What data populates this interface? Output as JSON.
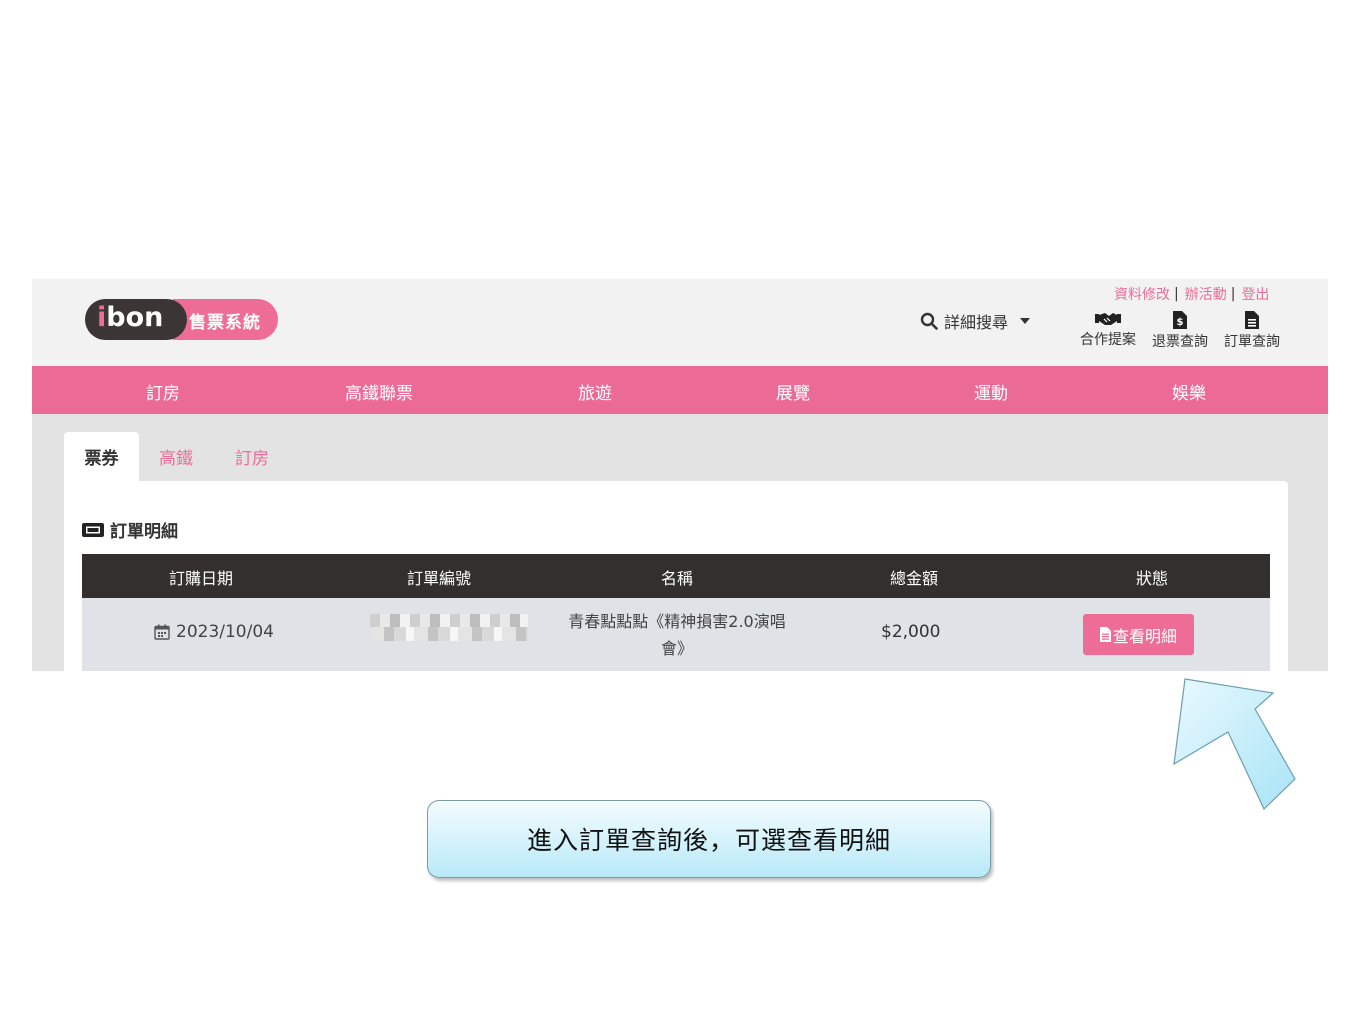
{
  "header": {
    "logo_word": "bon",
    "logo_i": "i",
    "logo_tagline": "售票系統",
    "search_label": "詳細搜尋",
    "top_links": [
      {
        "label": "資料修改"
      },
      {
        "label": "辦活動"
      },
      {
        "label": "登出"
      }
    ],
    "quick_links": [
      {
        "label": "合作提案",
        "icon": "handshake-icon"
      },
      {
        "label": "退票查詢",
        "icon": "refund-document-icon"
      },
      {
        "label": "訂單查詢",
        "icon": "document-icon"
      }
    ]
  },
  "nav": {
    "items": [
      {
        "label": "訂房"
      },
      {
        "label": "高鐵聯票"
      },
      {
        "label": "旅遊"
      },
      {
        "label": "展覽"
      },
      {
        "label": "運動"
      },
      {
        "label": "娛樂"
      }
    ]
  },
  "tabs": [
    {
      "label": "票券",
      "active": true
    },
    {
      "label": "高鐵",
      "active": false
    },
    {
      "label": "訂房",
      "active": false
    }
  ],
  "section": {
    "title": "訂單明細",
    "icon": "ticket-icon"
  },
  "table": {
    "headers": [
      "訂購日期",
      "訂單編號",
      "名稱",
      "總金額",
      "狀態"
    ],
    "rows": [
      {
        "date": "2023/10/04",
        "order_id_blurred": true,
        "name": "青春點點點《精神損害2.0演唱會》",
        "total": "$2,000",
        "action_label": "查看明細"
      }
    ]
  },
  "annotation": {
    "callout_text": "進入訂單查詢後，可選查看明細",
    "arrow_color": "#c9eefa"
  },
  "colors": {
    "brand_pink": "#ec6b96",
    "dark": "#332f2f"
  }
}
